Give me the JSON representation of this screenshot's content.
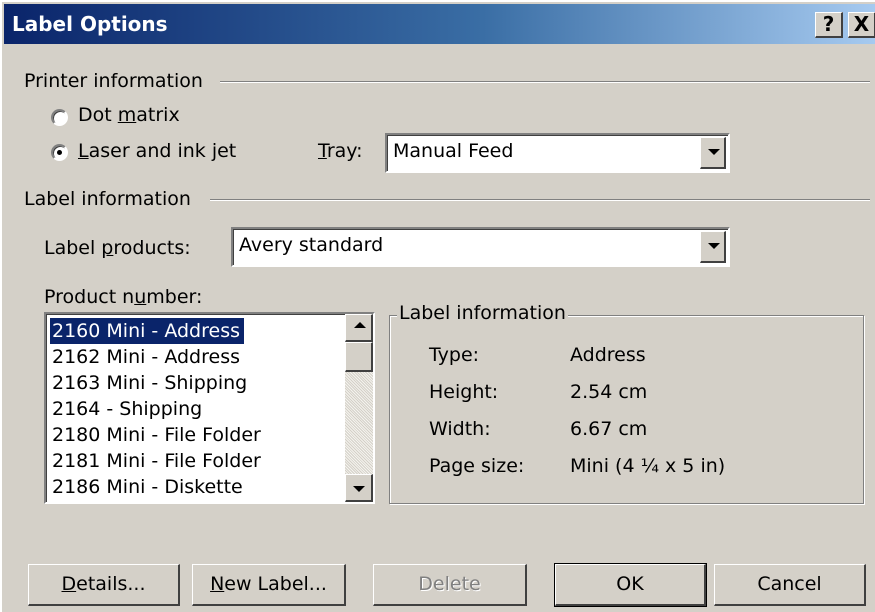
{
  "window": {
    "title": "Label Options",
    "help_glyph": "?",
    "close_glyph": "X"
  },
  "printer": {
    "heading": "Printer information",
    "dot_matrix": {
      "pre": "Dot ",
      "key": "m",
      "post": "atrix",
      "selected": false
    },
    "laser": {
      "pre": "",
      "key": "L",
      "post": "aser and ink jet",
      "selected": true
    },
    "tray_label": {
      "pre": "",
      "key": "T",
      "post": "ray:"
    },
    "tray_value": "Manual Feed"
  },
  "label": {
    "heading": "Label information",
    "products_label": {
      "pre": "Label ",
      "key": "p",
      "post": "roducts:"
    },
    "products_value": "Avery standard",
    "product_number_label": {
      "pre": "Product n",
      "key": "u",
      "post": "mber:"
    },
    "product_numbers": [
      "2160 Mini - Address",
      "2162 Mini - Address",
      "2163 Mini - Shipping",
      "2164 - Shipping",
      "2180 Mini - File Folder",
      "2181 Mini - File Folder",
      "2186 Mini - Diskette"
    ],
    "selected_index": 0
  },
  "info": {
    "heading": "Label information",
    "type_label": "Type:",
    "type_value": "Address",
    "height_label": "Height:",
    "height_value": "2.54 cm",
    "width_label": "Width:",
    "width_value": "6.67 cm",
    "page_size_label": "Page size:",
    "page_size_value": "Mini (4 ¼ x 5 in)"
  },
  "buttons": {
    "details": {
      "pre": "",
      "key": "D",
      "post": "etails..."
    },
    "new_label": {
      "pre": "",
      "key": "N",
      "post": "ew Label..."
    },
    "delete": "Delete",
    "ok": "OK",
    "cancel": "Cancel"
  }
}
